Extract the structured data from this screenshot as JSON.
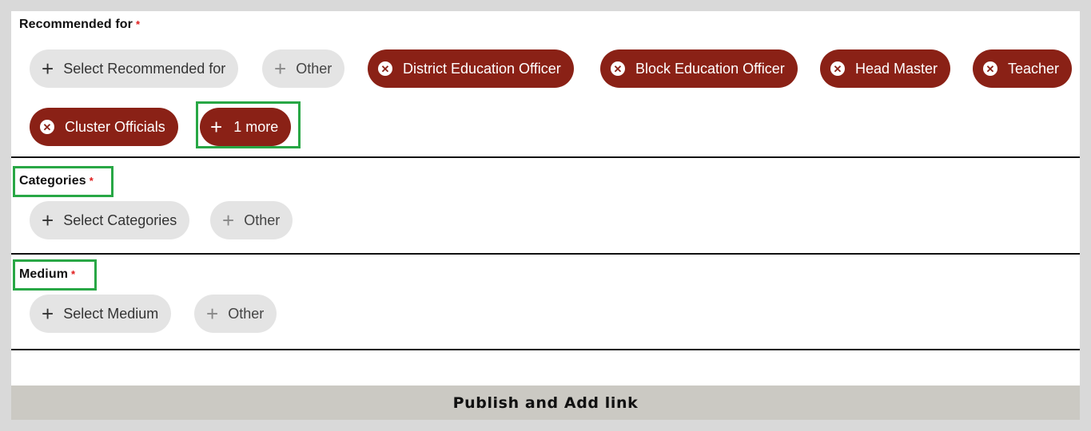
{
  "sections": {
    "recommended": {
      "label": "Recommended for",
      "required_mark": "*",
      "select_label": "Select Recommended for",
      "other_label": "Other",
      "selected": [
        "District Education Officer",
        "Block Education Officer",
        "Head Master",
        "Teacher",
        "Cluster Officials"
      ],
      "more_label": "1 more"
    },
    "categories": {
      "label": "Categories",
      "required_mark": "*",
      "select_label": "Select Categories",
      "other_label": "Other"
    },
    "medium": {
      "label": "Medium",
      "required_mark": "*",
      "select_label": "Select Medium",
      "other_label": "Other"
    }
  },
  "publish_button": {
    "label": "Publish and Add link"
  },
  "icons": {
    "add": "plus-icon",
    "remove": "close-circle-icon"
  },
  "colors": {
    "selected_chip": "#8a2116",
    "unselected_chip": "#e4e4e4",
    "highlight": "#28a745",
    "required": "#e01b1b",
    "publish_bg": "#cbc9c3"
  }
}
